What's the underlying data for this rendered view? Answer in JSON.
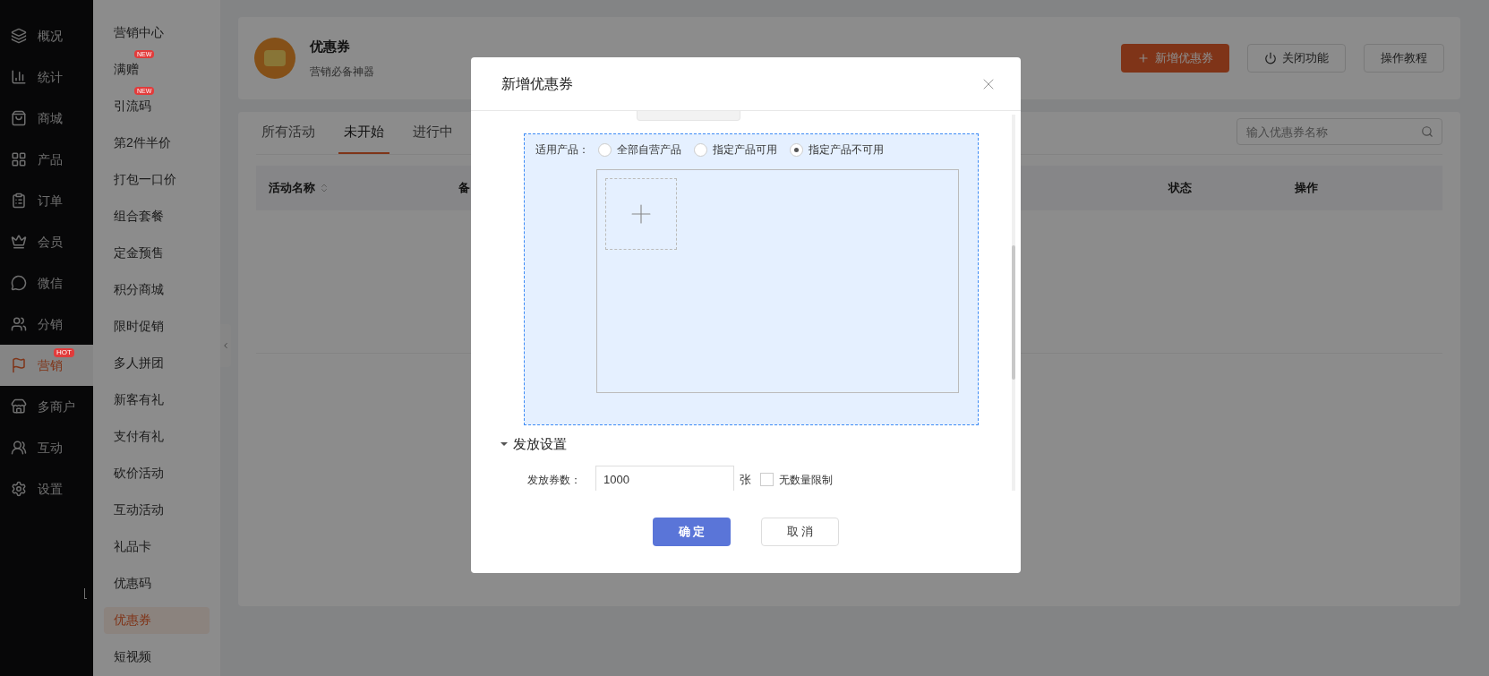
{
  "nav": [
    {
      "label": "概况",
      "selected": false
    },
    {
      "label": "统计",
      "selected": false
    },
    {
      "label": "商城",
      "selected": false
    },
    {
      "label": "产品",
      "selected": false
    },
    {
      "label": "订单",
      "selected": false
    },
    {
      "label": "会员",
      "selected": false
    },
    {
      "label": "微信",
      "selected": false
    },
    {
      "label": "分销",
      "selected": false
    },
    {
      "label": "营销",
      "selected": true,
      "badge": "HOT"
    },
    {
      "label": "多商户",
      "selected": false
    },
    {
      "label": "互动",
      "selected": false
    },
    {
      "label": "设置",
      "selected": false
    }
  ],
  "submenu": [
    {
      "label": "营销中心",
      "selected": false
    },
    {
      "label": "满赠",
      "selected": false,
      "badge": "NEW"
    },
    {
      "label": "引流码",
      "selected": false,
      "badge": "NEW"
    },
    {
      "label": "第2件半价",
      "selected": false
    },
    {
      "label": "打包一口价",
      "selected": false
    },
    {
      "label": "组合套餐",
      "selected": false
    },
    {
      "label": "定金预售",
      "selected": false
    },
    {
      "label": "积分商城",
      "selected": false
    },
    {
      "label": "限时促销",
      "selected": false
    },
    {
      "label": "多人拼团",
      "selected": false
    },
    {
      "label": "新客有礼",
      "selected": false
    },
    {
      "label": "支付有礼",
      "selected": false
    },
    {
      "label": "砍价活动",
      "selected": false
    },
    {
      "label": "互动活动",
      "selected": false
    },
    {
      "label": "礼品卡",
      "selected": false
    },
    {
      "label": "优惠码",
      "selected": false
    },
    {
      "label": "优惠券",
      "selected": true
    },
    {
      "label": "短视频",
      "selected": false
    }
  ],
  "header": {
    "title": "优惠券",
    "subtitle": "营销必备神器",
    "buttons": [
      {
        "label": "新增优惠券",
        "kind": "primary"
      },
      {
        "label": "关闭功能",
        "kind": "power"
      },
      {
        "label": "操作教程",
        "kind": "plain"
      }
    ]
  },
  "tabs": [
    {
      "label": "所有活动",
      "selected": false
    },
    {
      "label": "未开始",
      "selected": true
    },
    {
      "label": "进行中",
      "selected": false
    }
  ],
  "search": {
    "placeholder": "输入优惠券名称"
  },
  "table": {
    "columns": [
      {
        "label": "活动名称",
        "sortable": true
      },
      {
        "label": "备",
        "sortable": false
      },
      {
        "label": "状态",
        "sortable": false
      },
      {
        "label": "操作",
        "sortable": false
      }
    ]
  },
  "dialog": {
    "title": "新增优惠券",
    "scope": {
      "label": "适用产品：",
      "options": [
        {
          "label": "全部自营产品",
          "selected": false
        },
        {
          "label": "指定产品可用",
          "selected": false
        },
        {
          "label": "指定产品不可用",
          "selected": true
        }
      ]
    },
    "section": {
      "title": "发放设置",
      "expanded": true
    },
    "quantity": {
      "label": "发放券数：",
      "value": "1000",
      "unit": "张",
      "checkbox": {
        "label": "无数量限制",
        "checked": false
      }
    },
    "buttons": [
      {
        "label": "确 定",
        "kind": "primary"
      },
      {
        "label": "取 消",
        "kind": "plain"
      }
    ]
  }
}
